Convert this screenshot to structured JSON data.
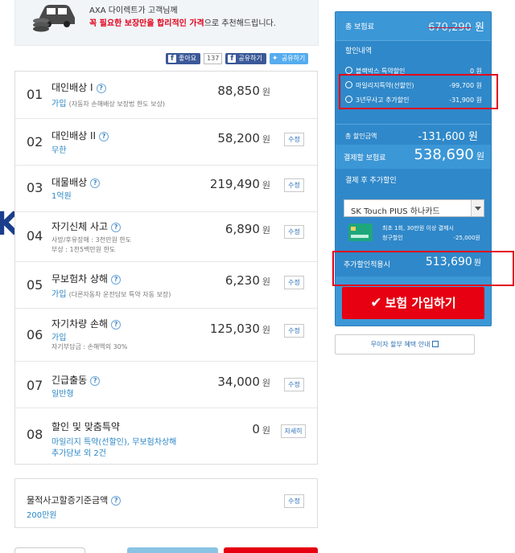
{
  "banner": {
    "line1": "AXA 다이렉트가 고객님께",
    "line2_highlight": "꼭 필요한 보장만을 합리적인 가격",
    "line2_rest": "으로 추천해드립니다."
  },
  "social": {
    "like_label": "좋아요",
    "like_count": "137",
    "share_label": "공유하기",
    "tweet_label": "공유하기"
  },
  "coverages": [
    {
      "no": "01",
      "title": "대인배상 I",
      "sub": "가입",
      "sub_note": "(자동차 손해배상 보장법 한도 보상)",
      "price": "88,850",
      "won": "원",
      "button": ""
    },
    {
      "no": "02",
      "title": "대인배상 II",
      "sub": "무한",
      "price": "58,200",
      "won": "원",
      "button": "수정"
    },
    {
      "no": "03",
      "title": "대물배상",
      "sub": "1억원",
      "price": "219,490",
      "won": "원",
      "button": "수정"
    },
    {
      "no": "04",
      "title": "자기신체 사고",
      "small1": "사망/후유장해 : 3천만원 한도",
      "small2": "부상 : 1천5백만원 한도",
      "price": "6,890",
      "won": "원",
      "button": "수정"
    },
    {
      "no": "05",
      "title": "무보험차 상해",
      "sub": "가입",
      "sub_note": "(다른자동차 운전담보 특약 자동 보장)",
      "price": "6,230",
      "won": "원",
      "button": "수정"
    },
    {
      "no": "06",
      "title": "자기차량 손해",
      "sub": "가입",
      "small1": "자기부담금 : 손해액의 30%",
      "price": "125,030",
      "won": "원",
      "button": "수정"
    },
    {
      "no": "07",
      "title": "긴급출동",
      "sub": "일반형",
      "price": "34,000",
      "won": "원",
      "button": "수정"
    },
    {
      "no": "08",
      "title": "할인 및 맞춤특약",
      "sub": "마일리지 특약(선할인), 무보험차상해",
      "sub2": "추가담보 외 2건",
      "price": "0",
      "won": "원",
      "button": "자세히"
    }
  ],
  "property": {
    "title": "물적사고할증기준금액",
    "value": "200만원",
    "button": "수정"
  },
  "summary": {
    "total_label": "총 보험료",
    "total_value": "670,290",
    "total_won": "원",
    "discount_label": "할인내역",
    "discounts": [
      {
        "label": "블랙박스 특약할인",
        "amount": "0 원"
      },
      {
        "label": "마일리지특약(선할인)",
        "amount": "-99,700 원"
      },
      {
        "label": "3년무사고 추가할인",
        "amount": "-31,900 원"
      }
    ],
    "discount_sum_label": "총 할인금액",
    "discount_sum_value": "-131,600 원",
    "pay_label": "결제할 보험료",
    "pay_value": "538,690",
    "pay_won": "원",
    "after_label": "결제 후 추가할인",
    "card_select": "SK Touch PIUS 하나카드",
    "card_note1": "최초 1회, 30만원 이상 결제시",
    "card_note2": "청구할인",
    "card_discount": "-25,000원",
    "estimate_label": "추가할인적용시",
    "estimate_value": "513,690",
    "estimate_won": "원",
    "join_label": "보험 가입하기",
    "interest_label": "무이자 할부 혜택 안내"
  },
  "colors": {
    "panel_blue": "#3c97d6",
    "join_red": "#e60012",
    "highlight_red": "#e2001a",
    "link_blue": "#2a86c7"
  }
}
